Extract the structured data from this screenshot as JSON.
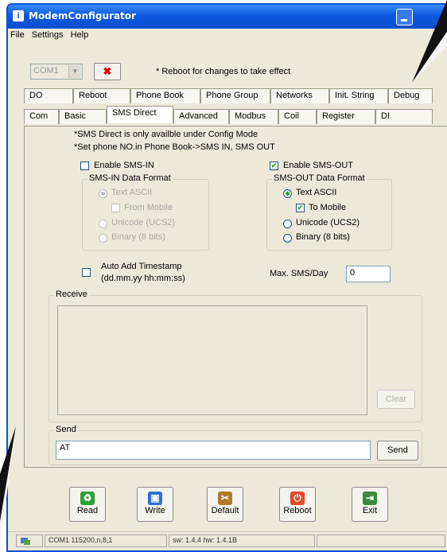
{
  "window": {
    "title": "ModemConfigurator"
  },
  "menu": [
    "File",
    "Settings",
    "Help"
  ],
  "top": {
    "com_port": "COM1",
    "clear_symbol": "✖",
    "note": "* Reboot for changes to take effect"
  },
  "tabs_row1": [
    "DO",
    "Reboot",
    "Phone Book",
    "Phone Group",
    "Networks",
    "Init. String",
    "Debug"
  ],
  "tabs_row2": [
    "Com",
    "Basic",
    "SMS Direct",
    "Advanced",
    "Modbus",
    "Coil",
    "Register",
    "DI"
  ],
  "sms": {
    "note1": "*SMS Direct is only availble under Config Mode",
    "note2": "*Set phone NO.in Phone Book->SMS IN, SMS OUT",
    "enable_in": "Enable SMS-IN",
    "enable_out": "Enable SMS-OUT",
    "in_format": "SMS-IN Data Format",
    "out_format": "SMS-OUT Data Format",
    "text_ascii": "Text ASCII",
    "from_mobile": "From Mobile",
    "to_mobile": "To Mobile",
    "unicode": "Unicode (UCS2)",
    "binary": "Binary (8 bits)",
    "timestamp_1": "Auto Add Timestamp",
    "timestamp_2": "(dd.mm.yy hh:mm:ss)",
    "max_label": "Max. SMS/Day",
    "max_value": "0",
    "receive": "Receive",
    "clear": "Clear",
    "send_group": "Send",
    "send_value": "AT",
    "send_btn": "Send"
  },
  "toolbar": [
    "Read",
    "Write",
    "Default",
    "Reboot",
    "Exit"
  ],
  "status": {
    "conn": "COM1 115200,n,8,1",
    "version": "sw: 1.4.4 hw: 1.4.1B"
  },
  "icons": {
    "app": "app-icon",
    "read": "recycle-icon",
    "write": "computer-icon",
    "default": "tools-icon",
    "reboot": "power-icon",
    "exit": "exit-door-icon"
  }
}
